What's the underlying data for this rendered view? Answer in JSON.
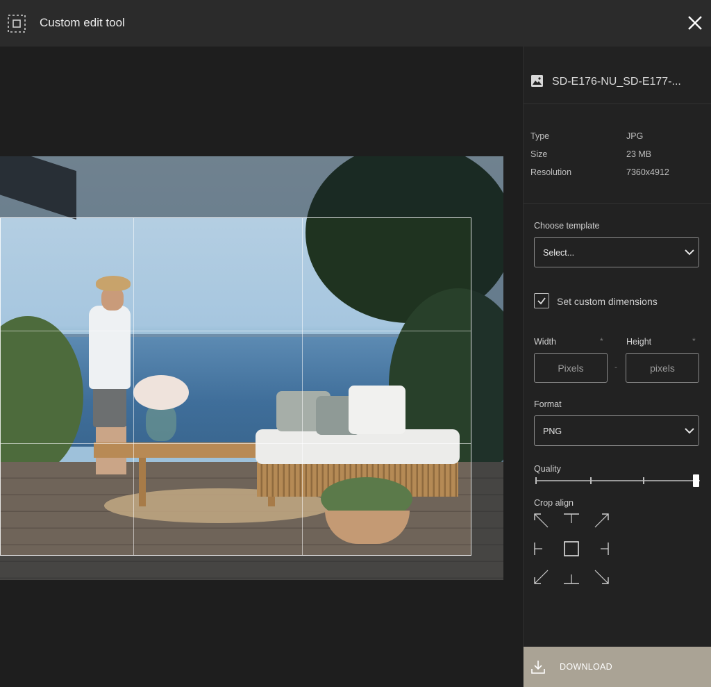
{
  "header": {
    "title": "Custom edit tool",
    "tool_icon": "crop-select-icon",
    "close_icon": "close-icon"
  },
  "file": {
    "name": "SD-E176-NU_SD-E177-...",
    "icon": "image-icon",
    "meta": [
      {
        "key": "Type",
        "value": "JPG"
      },
      {
        "key": "Size",
        "value": "23 MB"
      },
      {
        "key": "Resolution",
        "value": "7360x4912"
      }
    ]
  },
  "template": {
    "label": "Choose template",
    "value": "Select..."
  },
  "custom_dimensions": {
    "label": "Set custom dimensions",
    "checked": true,
    "width_label": "Width",
    "height_label": "Height",
    "width_placeholder": "Pixels",
    "height_placeholder": "pixels",
    "required_mark": "*",
    "separator": "-"
  },
  "format": {
    "label": "Format",
    "value": "PNG"
  },
  "quality": {
    "label": "Quality",
    "level": 1.0
  },
  "crop_align": {
    "label": "Crop align",
    "selected": "center"
  },
  "download": {
    "label": "DOWNLOAD",
    "icon": "download-icon"
  },
  "colors": {
    "header_bg": "#2b2b2b",
    "panel_bg": "#222222",
    "download_bg": "#aaa395"
  }
}
